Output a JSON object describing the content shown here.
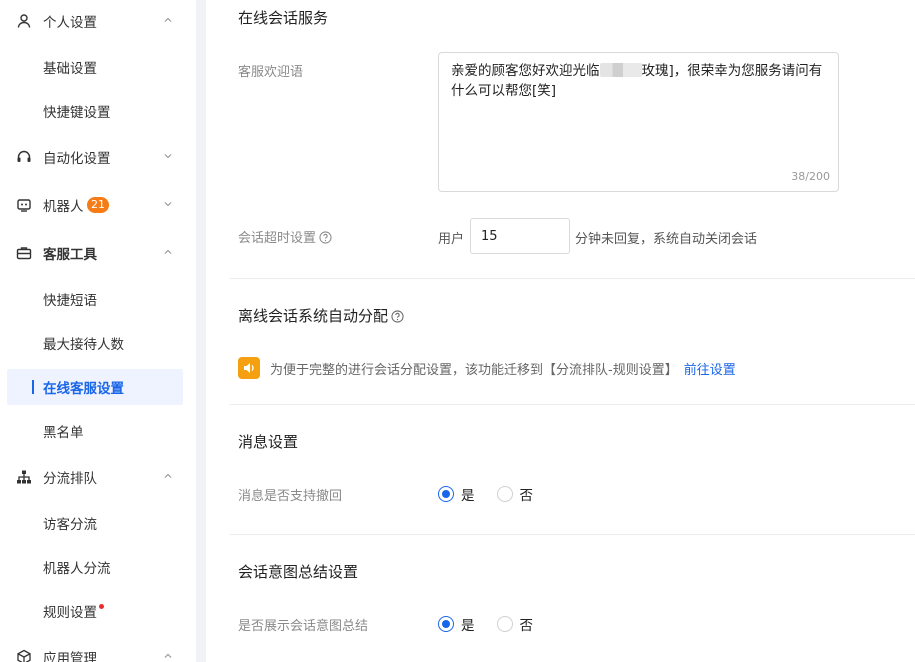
{
  "sidebar": {
    "groups": [
      {
        "label": "个人设置",
        "icon": "user-icon",
        "chevron": "up"
      },
      {
        "label": "自动化设置",
        "icon": "headset-icon",
        "chevron": "down"
      },
      {
        "label": "机器人",
        "icon": "robot-icon",
        "chevron": "down",
        "badge": "21"
      },
      {
        "label": "客服工具",
        "icon": "toolbox-icon",
        "chevron": "up"
      },
      {
        "label": "分流排队",
        "icon": "org-chart-icon",
        "chevron": "up"
      },
      {
        "label": "应用管理",
        "icon": "cube-icon",
        "chevron": "up"
      }
    ],
    "items": [
      {
        "label": "基础设置"
      },
      {
        "label": "快捷键设置"
      },
      {
        "label": "快捷短语"
      },
      {
        "label": "最大接待人数"
      },
      {
        "label": "在线客服设置",
        "active": true
      },
      {
        "label": "黑名单"
      },
      {
        "label": "访客分流"
      },
      {
        "label": "机器人分流"
      },
      {
        "label": "规则设置",
        "dot": true
      }
    ]
  },
  "online_session": {
    "title": "在线会话服务",
    "welcome_label": "客服欢迎语",
    "welcome_text_before": "亲爱的顾客您好欢迎光临",
    "welcome_text_after": "玫瑰]，很荣幸为您服务请问有什么可以帮您[笑]",
    "counter": "38/200",
    "timeout_label": "会话超时设置",
    "timeout_prefix": "用户",
    "timeout_value": "15",
    "timeout_suffix": "分钟未回复，系统自动关闭会话"
  },
  "offline_assign": {
    "title": "离线会话系统自动分配",
    "notice": "为便于完整的进行会话分配设置，该功能迁移到【分流排队-规则设置】",
    "link": "前往设置"
  },
  "message_settings": {
    "title": "消息设置",
    "recall_label": "消息是否支持撤回",
    "yes": "是",
    "no": "否",
    "selected": "是"
  },
  "intent_summary": {
    "title": "会话意图总结设置",
    "show_label": "是否展示会话意图总结",
    "yes": "是",
    "no": "否",
    "selected": "是"
  },
  "colors": {
    "accent": "#1a66e8",
    "badge": "#f57c16",
    "notice_icon": "#f5a011",
    "red_dot": "#ee2c2c"
  }
}
